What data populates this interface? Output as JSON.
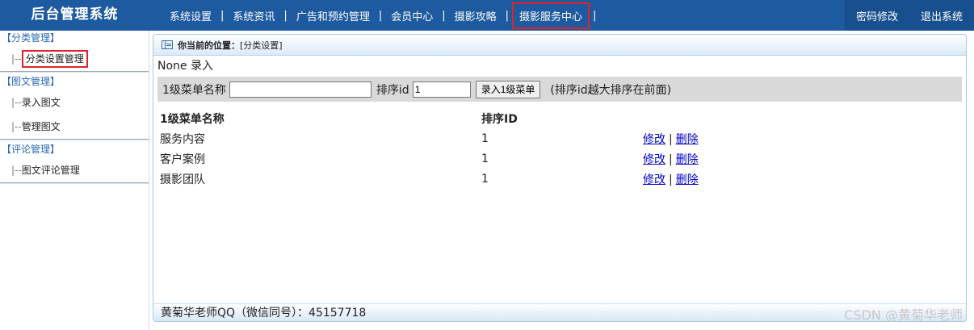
{
  "header": {
    "brand": "后台管理系统",
    "nav": [
      "系统设置",
      "系统资讯",
      "广告和预约管理",
      "会员中心",
      "摄影攻略",
      "摄影服务中心"
    ],
    "nav_separator": "|",
    "password_change": "密码修改",
    "logout": "退出系统"
  },
  "sidebar": {
    "groups": [
      {
        "title": "【分类管理】",
        "items": [
          {
            "prefix": "|--",
            "label": "分类设置管理"
          }
        ]
      },
      {
        "title": "【图文管理】",
        "items": [
          {
            "prefix": "|--",
            "label": "录入图文"
          },
          {
            "prefix": "|--",
            "label": "管理图文"
          }
        ]
      },
      {
        "title": "【评论管理】",
        "items": [
          {
            "prefix": "|--",
            "label": "图文评论管理"
          }
        ]
      }
    ]
  },
  "main": {
    "location_label": "你当前的位置：",
    "location_value": "[分类设置]",
    "mode_text": "None 录入",
    "form": {
      "name_label": "1级菜单名称",
      "name_value": "",
      "order_label": "排序id",
      "order_value": "1",
      "submit_label": "录入1级菜单",
      "hint": "(排序id越大排序在前面)"
    },
    "table": {
      "headers": [
        "1级菜单名称",
        "排序ID",
        ""
      ],
      "rows": [
        {
          "name": "服务内容",
          "order": "1",
          "edit": "修改",
          "delete": "删除"
        },
        {
          "name": "客户案例",
          "order": "1",
          "edit": "修改",
          "delete": "删除"
        },
        {
          "name": "摄影团队",
          "order": "1",
          "edit": "修改",
          "delete": "删除"
        }
      ],
      "action_separator": "|"
    },
    "footer": "黄菊华老师QQ（微信同号）：45157718"
  },
  "watermark": "CSDN @黄菊华老师",
  "colors": {
    "header_bg": "#1e5aa0",
    "highlight_border": "#e0232a",
    "link": "#0000cc"
  }
}
